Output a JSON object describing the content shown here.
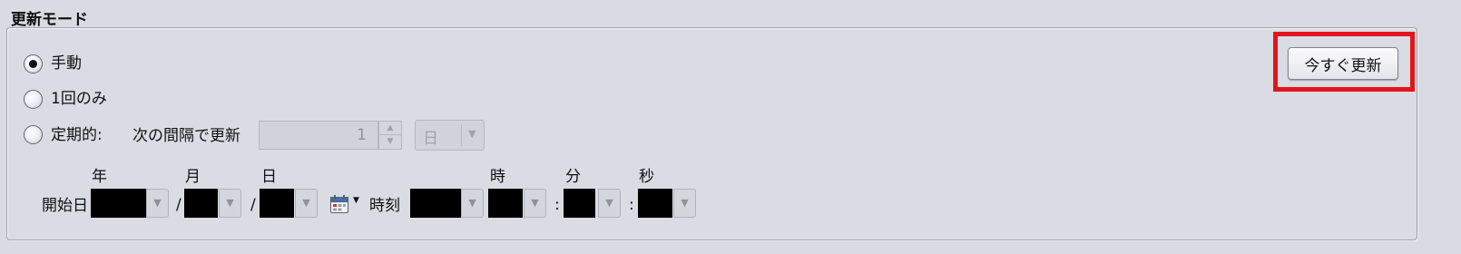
{
  "section_title": "更新モード",
  "mode": {
    "options": [
      {
        "label": "手動",
        "selected": true
      },
      {
        "label": "1回のみ",
        "selected": false
      },
      {
        "label": "定期的:",
        "selected": false
      }
    ],
    "interval_label": "次の間隔で更新",
    "interval_value": "1",
    "interval_unit": "日"
  },
  "start": {
    "label": "開始日",
    "year_header": "年",
    "month_header": "月",
    "day_header": "日",
    "date_sep": "/",
    "time_label": "時刻",
    "hour_header": "時",
    "minute_header": "分",
    "second_header": "秒",
    "time_sep": ":"
  },
  "refresh_button_label": "今すぐ更新",
  "colors": {
    "highlight": "#e3141c",
    "background": "#d8dbe2"
  }
}
